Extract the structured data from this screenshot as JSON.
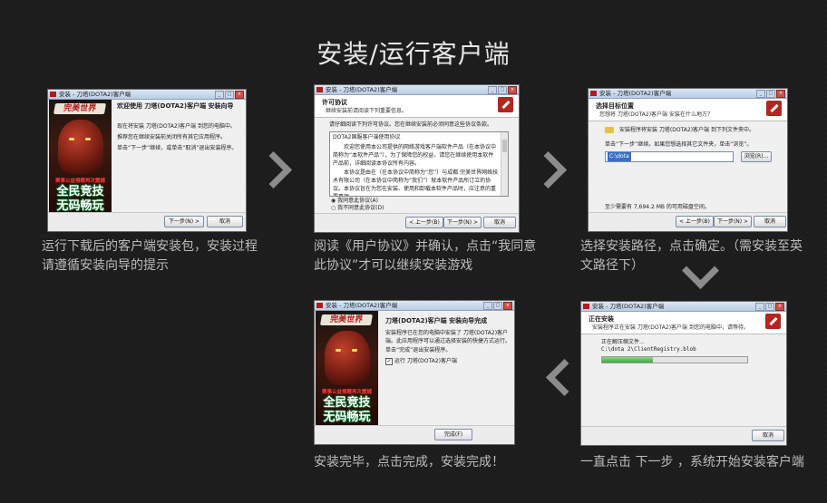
{
  "page": {
    "title": "安装/运行客户端"
  },
  "captions": {
    "s1": "运行下载后的客户端安装包，安装过程请遵循安装向导的提示",
    "s2": "阅读《用户协议》并确认，点击“我同意此协议”才可以继续安装游戏",
    "s3": "选择安装路径，点击确定。（需安装至英文路径下）",
    "s4": "一直点击 下一步 ，系统开始安装客户端",
    "s5": "安装完毕，点击完成，安装完成！"
  },
  "common": {
    "window_title_1": "安装 - 刀塔(DOTA2)客户端",
    "window_title_2": "安装 - 刀塔(DOTA2)客户端",
    "logo": "完美世界",
    "promo_small": "赛事公益捐赠再次震撼",
    "promo_line1": "全民竞技",
    "promo_line2": "无码畅玩",
    "btn_back": "< 上一步(B)",
    "btn_next": "下一步(N) >",
    "btn_cancel": "取消",
    "btn_finish": "完成(F)",
    "btn_browse": "浏览(R)..."
  },
  "w1": {
    "heading": "欢迎使用 刀塔(DOTA2)客户端 安装向导",
    "p1": "现在将安装 刀塔(DOTA2)客户端 到您的电脑中。",
    "p2": "推荐您在继续安装前关闭所有其它应用程序。",
    "p3": "单击“下一步”继续，或单击“取消”退出安装程序。"
  },
  "w2": {
    "h1": "许可协议",
    "h2": "继续安装前请阅读下列重要信息。",
    "intro": "请仔细阅读下列许可协议。您在继续安装前必须同意这些协议条款。",
    "lic_title": "DOTA2国服客户端使用协议",
    "lic_p1": "欢迎您使用本公司提供的网络游戏客户端软件产品（在本协议中简称为“本软件产品”），为了保障您的权益，请您在继续使用本软件产品前，详细阅读本协议所有内容。",
    "lic_p2": "本协议是由在（在本协议中简称为“您”）与成都 完美世界网络技术有限公司（在本协议中简称为“我们”）就本软件产品所订立的协议。本协议旨在为您在安装、使用和卸载本软件产品时，应注意的重要事项。",
    "radio_accept": "我同意此协议(A)",
    "radio_decline": "我不同意此协议(D)"
  },
  "w3": {
    "h1": "选择目标位置",
    "h2": "您想将 刀塔(DOTA2)客户端 安装在什么地方？",
    "p1": "安装程序将安装 刀塔(DOTA2)客户端 到下列文件夹中。",
    "p2": "单击“下一步”继续。如果您想选择其它文件夹，单击“浏览”。",
    "path": "C:\\dota",
    "space": "至少需要有 7,694.2 MB 的可用磁盘空间。"
  },
  "w4": {
    "h1": "正在安装",
    "h2": "安装程序正在安装 刀塔(DOTA2)客户端 到您的电脑中，请等待。",
    "status": "正在解压缩文件...",
    "file": "C:\\dota 2\\ClientRegistry.blob",
    "progress": 0.35
  },
  "w5": {
    "heading": "刀塔(DOTA2)客户端 安装向导完成",
    "p1": "安装程序已在您的电脑中安装了 刀塔(DOTA2)客户端。此应用程序可以通过选择安装的快捷方式运行。",
    "p2": "单击“完成”退出安装程序。",
    "check": "运行 刀塔(DOTA2)客户端"
  }
}
